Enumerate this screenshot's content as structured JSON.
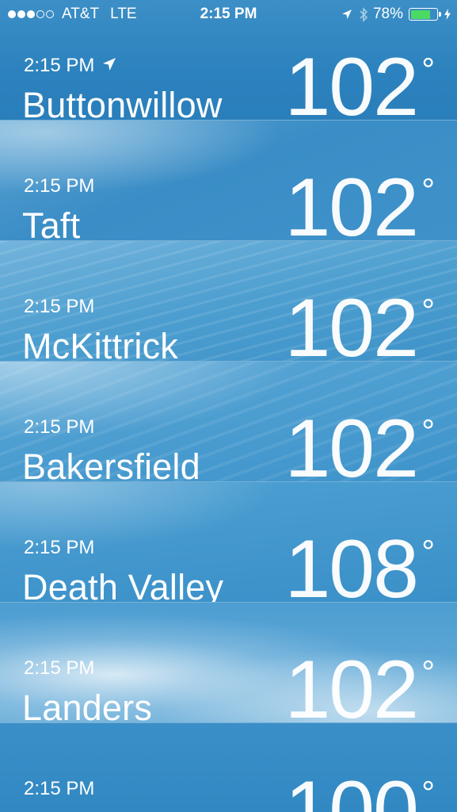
{
  "status_bar": {
    "signal_dots_full": 3,
    "signal_dots_empty": 2,
    "carrier": "AT&T",
    "network": "LTE",
    "time": "2:15 PM",
    "battery_percent": "78%",
    "battery_level": 0.78,
    "icons": [
      "location-arrow-icon",
      "bluetooth-icon",
      "battery-icon",
      "charging-bolt-icon"
    ]
  },
  "colors": {
    "sky_blue": "#2f86c0",
    "battery_green": "#4cd964"
  },
  "cities": [
    {
      "time": "2:15 PM",
      "name": "Buttonwillow",
      "temp": "102",
      "degree": "°",
      "current_location": true
    },
    {
      "time": "2:15 PM",
      "name": "Taft",
      "temp": "102",
      "degree": "°"
    },
    {
      "time": "2:15 PM",
      "name": "McKittrick",
      "temp": "102",
      "degree": "°"
    },
    {
      "time": "2:15 PM",
      "name": "Bakersfield",
      "temp": "102",
      "degree": "°"
    },
    {
      "time": "2:15 PM",
      "name": "Death Valley",
      "temp": "108",
      "degree": "°"
    },
    {
      "time": "2:15 PM",
      "name": "Landers",
      "temp": "102",
      "degree": "°"
    },
    {
      "time": "2:15 PM",
      "name": "",
      "temp": "100",
      "degree": "°"
    }
  ]
}
